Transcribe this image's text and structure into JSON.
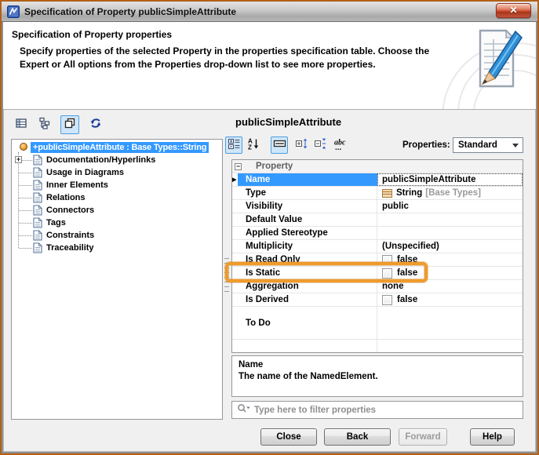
{
  "titlebar": {
    "title": "Specification of Property publicSimpleAttribute",
    "close_glyph": "✕"
  },
  "header": {
    "title": "Specification of Property properties",
    "description": [
      "Specify properties of the selected Property in the properties specification table. Choose the",
      "Expert or All options from the Properties drop-down list to see more properties."
    ]
  },
  "left": {
    "toolbar": [
      {
        "name": "table-view-icon",
        "selected": false
      },
      {
        "name": "tree-view-icon",
        "selected": false
      },
      {
        "name": "standalone-window-icon",
        "selected": true
      },
      {
        "name": "refresh-icon",
        "selected": false
      }
    ],
    "tree": [
      {
        "label": "+publicSimpleAttribute : Base Types::String",
        "icon": "attribute",
        "selected": true
      },
      {
        "label": "Documentation/Hyperlinks",
        "icon": "document",
        "expander": "+"
      },
      {
        "label": "Usage in Diagrams",
        "icon": "document"
      },
      {
        "label": "Inner Elements",
        "icon": "document"
      },
      {
        "label": "Relations",
        "icon": "document"
      },
      {
        "label": "Connectors",
        "icon": "document"
      },
      {
        "label": "Tags",
        "icon": "document"
      },
      {
        "label": "Constraints",
        "icon": "document"
      },
      {
        "label": "Traceability",
        "icon": "document"
      }
    ]
  },
  "right": {
    "title": "publicSimpleAttribute",
    "toolbar": [
      {
        "name": "categorized-view-icon",
        "selected": true
      },
      {
        "name": "sort-alphabetic-icon",
        "selected": false
      },
      {
        "name": "show-description-icon",
        "selected": true
      },
      {
        "name": "expand-all-icon",
        "selected": false
      },
      {
        "name": "collapse-all-icon",
        "selected": false
      },
      {
        "name": "abbreviate-text-icon",
        "selected": false
      }
    ],
    "properties_label": "Properties:",
    "properties_value": "Standard",
    "group_label": "Property",
    "rows": [
      {
        "label": "Name",
        "value": "publicSimpleAttribute",
        "type": "text",
        "selected": true
      },
      {
        "label": "Type",
        "value": "String",
        "suffix": "[Base Types]",
        "type": "typed"
      },
      {
        "label": "Visibility",
        "value": "public",
        "type": "text"
      },
      {
        "label": "Default Value",
        "value": "",
        "type": "text"
      },
      {
        "label": "Applied Stereotype",
        "value": "",
        "type": "text"
      },
      {
        "label": "Multiplicity",
        "value": "(Unspecified)",
        "type": "text"
      },
      {
        "label": "Is Read Only",
        "value": "false",
        "type": "checkbox"
      },
      {
        "label": "Is Static",
        "value": "false",
        "type": "checkbox",
        "annotated": true
      },
      {
        "label": "Aggregation",
        "value": "none",
        "type": "text"
      },
      {
        "label": "Is Derived",
        "value": "false",
        "type": "checkbox"
      },
      {
        "label": "To Do",
        "value": "",
        "type": "text",
        "tall": true
      }
    ],
    "description": {
      "title": "Name",
      "text": "The name of the NamedElement."
    },
    "filter_placeholder": "Type here to filter properties"
  },
  "footer": {
    "buttons": [
      {
        "label": "Close",
        "disabled": false
      },
      {
        "label": "Back",
        "disabled": false
      },
      {
        "label": "Forward",
        "disabled": true
      },
      {
        "label": "Help",
        "disabled": false
      }
    ]
  },
  "glyphs": {
    "expander_plus": "+",
    "group_collapse": "−",
    "row_marker": "▶"
  },
  "colors": {
    "selection_blue": "#3399ff",
    "annotation_orange": "#ef9b2b",
    "toolbar_selected_bg": "#cfe6f9",
    "toolbar_selected_border": "#4e9edd",
    "close_button_red": "#cf4a2e"
  }
}
